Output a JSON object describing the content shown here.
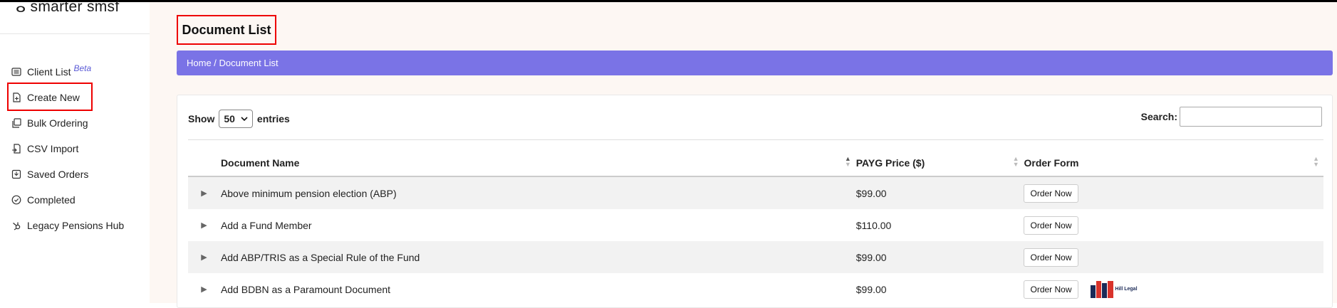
{
  "sidebar": {
    "logo_text": "smarter smsf",
    "items": [
      {
        "label": "Client List",
        "badge": "Beta",
        "icon": "list-icon"
      },
      {
        "label": "Create New",
        "icon": "file-plus-icon"
      },
      {
        "label": "Bulk Ordering",
        "icon": "copy-icon"
      },
      {
        "label": "CSV Import",
        "icon": "file-import-icon"
      },
      {
        "label": "Saved Orders",
        "icon": "save-icon"
      },
      {
        "label": "Completed",
        "icon": "check-circle-icon"
      },
      {
        "label": "Legacy Pensions Hub",
        "icon": "hubspot-icon"
      }
    ]
  },
  "header": {
    "title": "Document List",
    "breadcrumb": "Home / Document List"
  },
  "table_controls": {
    "show_label": "Show",
    "entries_value": "50",
    "entries_label": "entries",
    "search_label": "Search:",
    "search_value": ""
  },
  "table": {
    "columns": [
      "Document Name",
      "PAYG Price ($)",
      "Order Form"
    ],
    "rows": [
      {
        "name": "Above minimum pension election (ABP)",
        "price": "$99.00",
        "action": "Order Now"
      },
      {
        "name": "Add a Fund Member",
        "price": "$110.00",
        "action": "Order Now"
      },
      {
        "name": "Add ABP/TRIS as a Special Rule of the Fund",
        "price": "$99.00",
        "action": "Order Now"
      },
      {
        "name": "Add BDBN as a Paramount Document",
        "price": "$99.00",
        "action": "Order Now",
        "partner": "Hill Legal"
      }
    ]
  },
  "colors": {
    "accent": "#7a73e6",
    "highlight": "#e00000",
    "main_bg": "#fdf7f3"
  }
}
